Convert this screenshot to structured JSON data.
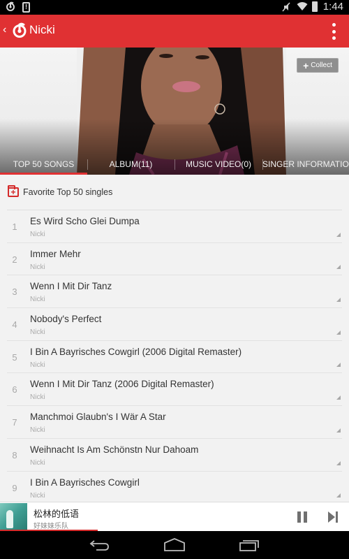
{
  "status_bar": {
    "left_icons": [
      "netease-music-icon",
      "alert-icon"
    ],
    "right_icons": [
      "mute-icon",
      "wifi-icon",
      "battery-icon"
    ],
    "time": "1:44"
  },
  "app_bar": {
    "back_icon": "back-chevron-icon",
    "logo_icon": "netease-music-logo-icon",
    "title": "Nicki",
    "menu_icon": "overflow-menu-icon"
  },
  "hero": {
    "collect_button": {
      "icon": "plus-icon",
      "label": "Collect"
    }
  },
  "tabs": [
    {
      "label": "TOP 50 SONGS",
      "active": true
    },
    {
      "label": "ALBUM(11)",
      "active": false
    },
    {
      "label": "MUSIC VIDEO(0)",
      "active": false
    },
    {
      "label": "SINGER INFORMATION",
      "active": false
    }
  ],
  "favorite": {
    "icon": "folder-add-icon",
    "label": "Favorite Top 50 singles"
  },
  "songs": [
    {
      "rank": "1",
      "title": "Es Wird Scho Glei Dumpa",
      "artist": "Nicki"
    },
    {
      "rank": "2",
      "title": "Immer Mehr",
      "artist": "Nicki"
    },
    {
      "rank": "3",
      "title": "Wenn I Mit Dir Tanz",
      "artist": "Nicki"
    },
    {
      "rank": "4",
      "title": "Nobody's Perfect",
      "artist": "Nicki"
    },
    {
      "rank": "5",
      "title": "I Bin A Bayrisches Cowgirl (2006 Digital Remaster)",
      "artist": "Nicki"
    },
    {
      "rank": "6",
      "title": "Wenn I Mit Dir Tanz (2006 Digital Remaster)",
      "artist": "Nicki"
    },
    {
      "rank": "7",
      "title": "Manchmoi Glaubn's I Wär A Star",
      "artist": "Nicki"
    },
    {
      "rank": "8",
      "title": "Weihnacht Is Am Schönstn Nur Dahoam",
      "artist": "Nicki"
    },
    {
      "rank": "9",
      "title": "I Bin A Bayrisches Cowgirl",
      "artist": "Nicki"
    }
  ],
  "player": {
    "title": "松林的低语",
    "artist": "好妹妹乐队",
    "progress_percent": 28,
    "pause_icon": "pause-icon",
    "next_icon": "skip-next-icon"
  },
  "nav_bar": {
    "back_icon": "nav-back-icon",
    "home_icon": "nav-home-icon",
    "recents_icon": "nav-recents-icon"
  },
  "colors": {
    "accent": "#e03133",
    "status_bar": "#000000",
    "list_background": "#f2f2f2"
  }
}
